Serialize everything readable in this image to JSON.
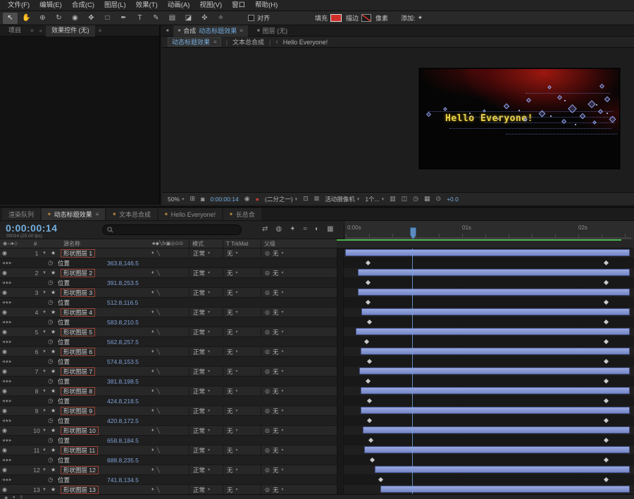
{
  "menu": {
    "items": [
      "文件(F)",
      "编辑(E)",
      "合成(C)",
      "图层(L)",
      "效果(T)",
      "动画(A)",
      "视图(V)",
      "窗口",
      "帮助(H)"
    ]
  },
  "toolbar": {
    "tools": [
      {
        "name": "selection",
        "glyph": "↖"
      },
      {
        "name": "hand",
        "glyph": "✋"
      },
      {
        "name": "zoom",
        "glyph": "⊕"
      },
      {
        "name": "rotate",
        "glyph": "↻"
      },
      {
        "name": "camera",
        "glyph": "◉"
      },
      {
        "name": "pan-behind",
        "glyph": "✥"
      },
      {
        "name": "shape",
        "glyph": "□"
      },
      {
        "name": "pen",
        "glyph": "✒"
      },
      {
        "name": "type",
        "glyph": "T"
      },
      {
        "name": "brush",
        "glyph": "✎"
      },
      {
        "name": "clone-stamp",
        "glyph": "▤"
      },
      {
        "name": "eraser",
        "glyph": "◪"
      },
      {
        "name": "roto-brush",
        "glyph": "✜"
      },
      {
        "name": "puppet",
        "glyph": "✧"
      }
    ],
    "align_label": "对齐",
    "fill_label": "填充",
    "stroke_label": "描边",
    "pixel_label": "像素",
    "add_label": "添加:"
  },
  "left_panel": {
    "tabs": [
      "项目",
      "效果控件 (无)"
    ]
  },
  "viewer": {
    "comp_tab_label": "合成",
    "comp_name": "动态标题效果",
    "layer_tab_label": "图层 (无)",
    "flow": {
      "main": "动态标题效果",
      "sub": "文本总合成",
      "current": "Hello Everyone!"
    },
    "preview": {
      "title_text": "Hello Everyone!"
    },
    "statusbar": {
      "items": [
        {
          "t": "50%",
          "caret": true,
          "n": "magnification-select"
        },
        {
          "g": "⊞",
          "n": "grid-guides-icon"
        },
        {
          "g": "◙",
          "n": "mask-visibility-icon"
        },
        {
          "t": "0:00:00:14",
          "blue": true,
          "n": "preview-time"
        },
        {
          "g": "◉",
          "n": "snapshot-icon"
        },
        {
          "g": "●",
          "red": true,
          "n": "show-channel-icon"
        },
        {
          "t": "(二分之一)",
          "caret": true,
          "n": "resolution-select"
        },
        {
          "g": "⊡",
          "n": "region-of-interest-icon"
        },
        {
          "g": "⊠",
          "n": "transparency-grid-icon"
        },
        {
          "t": "活动摄像机",
          "caret": true,
          "n": "camera-select"
        },
        {
          "t": "1个...",
          "caret": true,
          "n": "view-layout-select"
        },
        {
          "g": "▥",
          "n": "pixel-aspect-icon"
        },
        {
          "g": "◫",
          "n": "fast-previews-icon"
        },
        {
          "g": "◷",
          "n": "timeline-button-icon"
        },
        {
          "g": "▦",
          "n": "flowchart-button-icon"
        },
        {
          "g": "⊙",
          "n": "reset-exposure-icon"
        },
        {
          "t": "+0.0",
          "blue": true,
          "n": "exposure-value"
        }
      ]
    }
  },
  "timeline": {
    "tabs": [
      {
        "label": "渲染队列",
        "active": false,
        "icon": false
      },
      {
        "label": "动态标题效果",
        "active": true,
        "icon": true
      },
      {
        "label": "文本总合成",
        "active": false,
        "icon": true
      },
      {
        "label": "Hello Everyone!",
        "active": false,
        "icon": true
      },
      {
        "label": "长总合",
        "active": false,
        "icon": true
      }
    ],
    "timecode": "0:00:00:14",
    "frame_info": "00014 (25.00 fps)",
    "control_icons": [
      {
        "g": "⇄",
        "n": "comp-mini-flowchart-icon"
      },
      {
        "g": "◍",
        "n": "draft-3d-icon"
      },
      {
        "g": "✦",
        "n": "hide-shy-icon"
      },
      {
        "g": "≈",
        "n": "frame-blend-icon"
      },
      {
        "g": "◐",
        "n": "motion-blur-icon"
      },
      {
        "g": "▦",
        "n": "graph-editor-icon"
      }
    ],
    "columns": {
      "av": "◉◅●◇",
      "index": "#",
      "source_name": "源名称",
      "switches": "♣◆╲fx▣◎⊙⊙",
      "mode": "模式",
      "trkmat": "T TrkMat",
      "parent": "父级"
    },
    "mode_value": "正常",
    "trkmat_value": "无",
    "parent_value": "无",
    "property_label": "位置",
    "ruler": [
      "0:00s",
      "01s",
      "02s"
    ],
    "layers": [
      {
        "num": "1",
        "name": "形状图层 1",
        "position": "363.8,146.5",
        "bar_start": 2,
        "kf": [
          32,
          370
        ]
      },
      {
        "num": "2",
        "name": "形状图层 2",
        "position": "391.8,253.5",
        "bar_start": 20,
        "kf": [
          32,
          370
        ]
      },
      {
        "num": "3",
        "name": "形状图层 3",
        "position": "512.8,116.5",
        "bar_start": 20,
        "kf": [
          32,
          370
        ]
      },
      {
        "num": "4",
        "name": "形状图层 4",
        "position": "583.8,210.5",
        "bar_start": 25,
        "kf": [
          34,
          370
        ]
      },
      {
        "num": "5",
        "name": "形状图层 5",
        "position": "562.8,257.5",
        "bar_start": 17,
        "kf": [
          30,
          370
        ]
      },
      {
        "num": "6",
        "name": "形状图层 6",
        "position": "574.8,153.5",
        "bar_start": 24,
        "kf": [
          34,
          370
        ]
      },
      {
        "num": "7",
        "name": "形状图层 7",
        "position": "381.8,198.5",
        "bar_start": 22,
        "kf": [
          32,
          370
        ]
      },
      {
        "num": "8",
        "name": "形状图层 8",
        "position": "424.8,218.5",
        "bar_start": 24,
        "kf": [
          34,
          370
        ]
      },
      {
        "num": "9",
        "name": "形状图层 9",
        "position": "420.8,172.5",
        "bar_start": 24,
        "kf": [
          34,
          370
        ]
      },
      {
        "num": "10",
        "name": "形状图层 10",
        "position": "658.8,184.5",
        "bar_start": 27,
        "kf": [
          36,
          370
        ]
      },
      {
        "num": "11",
        "name": "形状图层 11",
        "position": "688.8,235.5",
        "bar_start": 29,
        "kf": [
          38,
          370
        ]
      },
      {
        "num": "12",
        "name": "形状图层 12",
        "position": "741.8,134.5",
        "bar_start": 44,
        "kf": [
          50,
          370
        ]
      },
      {
        "num": "13",
        "name": "形状图层 13",
        "position": "",
        "bar_start": 52,
        "kf": [
          58,
          370
        ]
      }
    ],
    "bar_end": 406,
    "status_icons": [
      {
        "g": "◉",
        "n": "expand-layer-switches-icon"
      },
      {
        "g": "♦",
        "n": "expand-transfer-controls-icon"
      },
      {
        "g": "≡",
        "n": "expand-inout-controls-icon"
      }
    ]
  }
}
